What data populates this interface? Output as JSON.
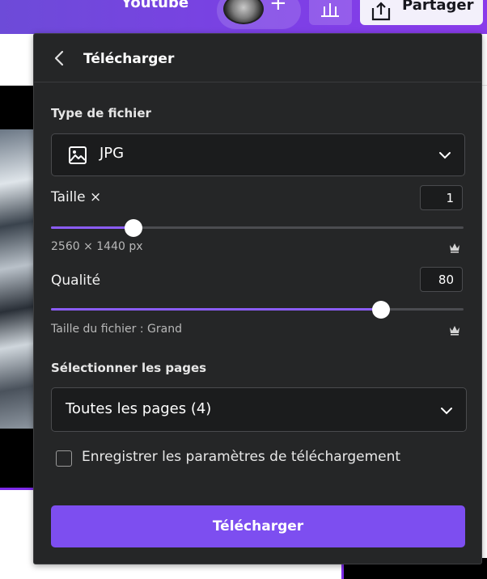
{
  "topbar": {
    "project_title": "Youtube",
    "add_collaborator_symbol": "+",
    "share_label": "Partager",
    "accent_color": "#7d3fe6"
  },
  "panel": {
    "title": "Télécharger",
    "file_type": {
      "label": "Type de fichier",
      "value": "JPG",
      "icon": "image-icon"
    },
    "size": {
      "label": "Taille ×",
      "value": "1",
      "slider_fraction": 0.2,
      "dimensions": "2560 × 1440 px",
      "premium_icon": "crown-icon"
    },
    "quality": {
      "label": "Qualité",
      "value": "80",
      "slider_fraction": 0.8,
      "file_size_text": "Taille du fichier : Grand",
      "premium_icon": "crown-icon"
    },
    "pages": {
      "label": "Sélectionner les pages",
      "value": "Toutes les pages (4)"
    },
    "save_settings": {
      "label": "Enregistrer les paramètres de téléchargement",
      "checked": false
    },
    "download_button": "Télécharger",
    "button_color": "#7d4ef0",
    "slider_color": "#8b5cf6"
  }
}
